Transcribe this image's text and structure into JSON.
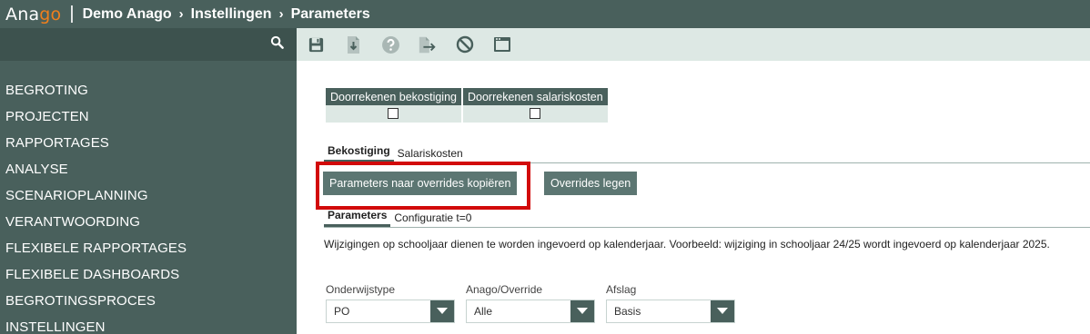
{
  "header": {
    "logo_part1": "Ana",
    "logo_part2": "go",
    "separator": "|",
    "breadcrumb": [
      "Demo Anago",
      "Instellingen",
      "Parameters"
    ],
    "chevron": "›"
  },
  "sidebar": {
    "menu": [
      "BEGROTING",
      "PROJECTEN",
      "RAPPORTAGES",
      "ANALYSE",
      "SCENARIOPLANNING",
      "VERANTWOORDING",
      "FLEXIBELE RAPPORTAGES",
      "FLEXIBELE DASHBOARDS",
      "BEGROTINGSPROCES",
      "INSTELLINGEN"
    ]
  },
  "toolbar": {
    "icons": [
      "save-icon",
      "download-icon",
      "help-icon",
      "export-icon",
      "cancel-icon",
      "window-icon"
    ]
  },
  "recalc_table": {
    "headers": [
      "Doorrekenen bekostiging",
      "Doorrekenen salariskosten"
    ]
  },
  "tabs_main": [
    "Bekostiging",
    "Salariskosten"
  ],
  "buttons": {
    "copy": "Parameters naar overrides kopiëren",
    "clear": "Overrides legen"
  },
  "tabs_sub": [
    "Parameters",
    "Configuratie t=0"
  ],
  "info_text": "Wijzigingen op schooljaar dienen te worden ingevoerd op kalenderjaar. Voorbeeld: wijziging in schooljaar 24/25 wordt ingevoerd op kalenderjaar 2025.",
  "filters": [
    {
      "label": "Onderwijstype",
      "value": "PO"
    },
    {
      "label": "Anago/Override",
      "value": "Alle"
    },
    {
      "label": "Afslag",
      "value": "Basis"
    }
  ],
  "colors": {
    "primary": "#49605c",
    "accent": "#f07f1c",
    "highlight": "#d20a0a"
  }
}
